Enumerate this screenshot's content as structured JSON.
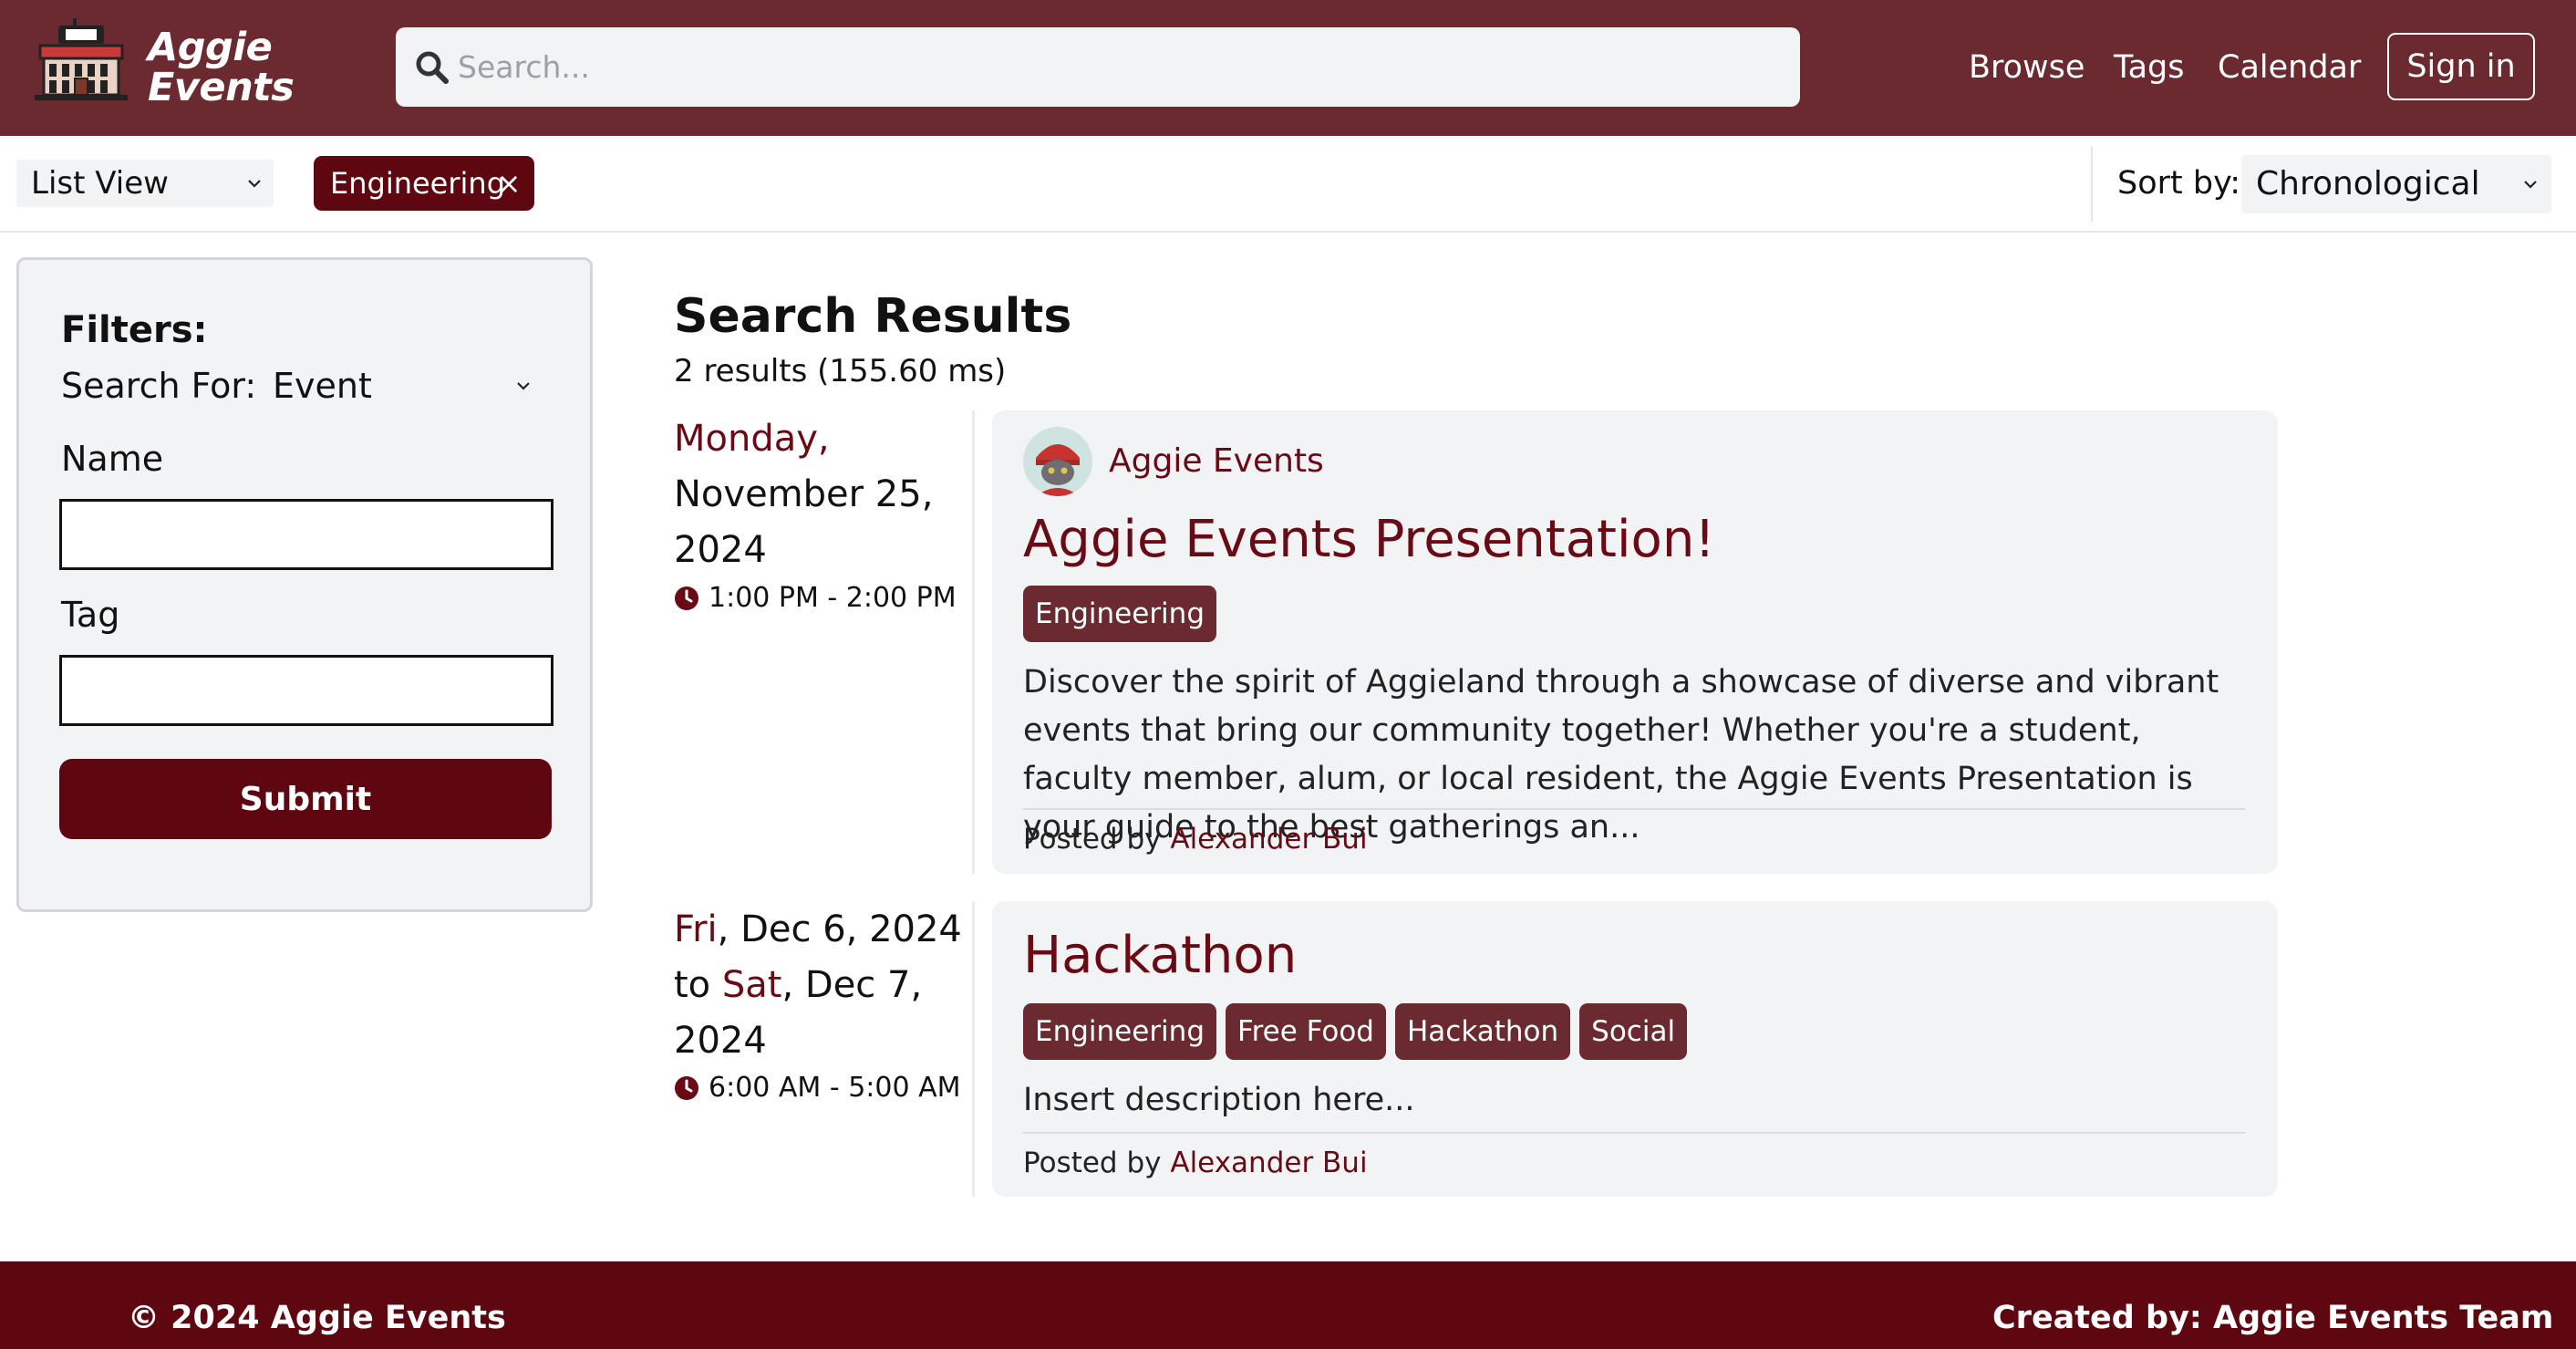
{
  "header": {
    "logo_line1": "Aggie",
    "logo_line2": "Events",
    "search_placeholder": "Search...",
    "nav": [
      "Browse",
      "Tags",
      "Calendar"
    ],
    "signin_label": "Sign in"
  },
  "toolbar": {
    "view_value": "List View",
    "active_filter": "Engineering",
    "remove_symbol": "×",
    "sort_label": "Sort by:",
    "sort_value": "Chronological"
  },
  "sidebar": {
    "title": "Filters:",
    "search_for_label": "Search For:",
    "search_for_value": "Event",
    "name_label": "Name",
    "name_value": "",
    "tag_label": "Tag",
    "tag_value": "",
    "submit_label": "Submit"
  },
  "results": {
    "title": "Search Results",
    "count": "2 results (155.60 ms)",
    "events": [
      {
        "day": "Monday,",
        "date_rest_1": "November 25,",
        "date_rest_2": "2024",
        "time": "1:00 PM - 2:00 PM",
        "org": "Aggie Events",
        "title": "Aggie Events Presentation!",
        "tags": [
          "Engineering"
        ],
        "description": "Discover the spirit of Aggieland through a showcase of diverse and vibrant events that bring our community together! Whether you're a student, faculty member, alum, or local resident, the Aggie Events Presentation is your guide to the best gatherings an...",
        "posted_by_label": "Posted by",
        "author": "Alexander Bui"
      },
      {
        "start_day": "Fri",
        "start_date": ", Dec 6, 2024",
        "to_label": "to ",
        "end_day": "Sat",
        "end_date": ", Dec 7,",
        "end_year": "2024",
        "time": "6:00 AM - 5:00 AM",
        "title": "Hackathon",
        "tags": [
          "Engineering",
          "Free Food",
          "Hackathon",
          "Social"
        ],
        "description": "Insert description here...",
        "posted_by_label": "Posted by",
        "author": "Alexander Bui"
      }
    ]
  },
  "footer": {
    "copyright": "© 2024 Aggie Events",
    "credits": "Created by: Aggie Events Team"
  },
  "colors": {
    "header_bg": "#6a2a2f",
    "primary": "#5e0710",
    "accent_text": "#6a0a14",
    "tag_bg": "#6a2a2f",
    "panel_bg": "#f2f3f5"
  },
  "icons": [
    "building-logo-icon",
    "search-icon",
    "chevron-down-icon",
    "close-icon",
    "clock-icon",
    "avatar-cat-icon"
  ]
}
